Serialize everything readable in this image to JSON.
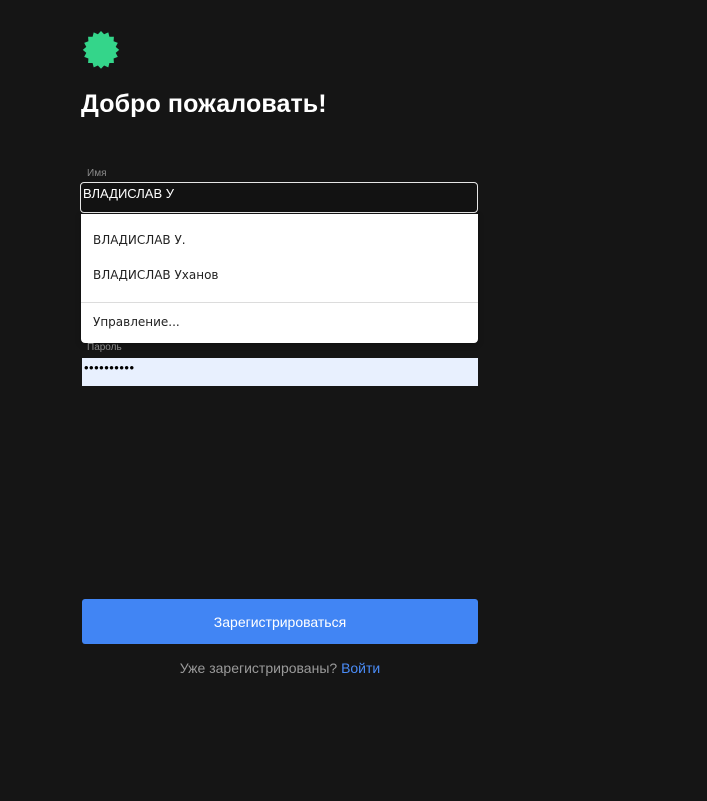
{
  "logo": {
    "icon": "badge-icon",
    "color": "#34d58a"
  },
  "header": {
    "title": "Добро пожаловать!"
  },
  "form": {
    "name_label": "Имя",
    "name_value": "ВЛАДИСЛАВ У",
    "password_label": "Пароль",
    "password_value": "••••••••••"
  },
  "autocomplete": {
    "suggestions": [
      "ВЛАДИСЛАВ У.",
      "ВЛАДИСЛАВ Уханов"
    ],
    "manage_label": "Управление..."
  },
  "actions": {
    "register_label": "Зарегистрироваться",
    "already_registered_text": "Уже зарегистрированы?",
    "login_link_label": "Войти"
  },
  "colors": {
    "background": "#151515",
    "accent": "#4185f4",
    "logo": "#34d58a",
    "autofill": "#e8f0fe"
  }
}
